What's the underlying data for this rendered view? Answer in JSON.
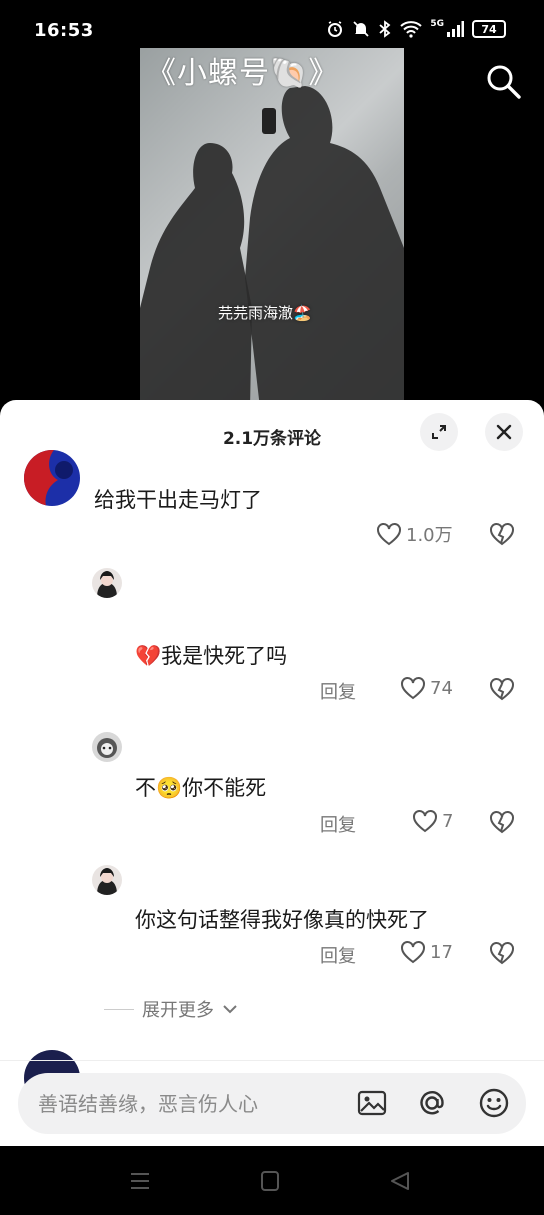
{
  "status_bar": {
    "time": "16:53",
    "network": "5G",
    "battery": "74",
    "icons": [
      "alarm-icon",
      "mute-icon",
      "bluetooth-icon",
      "wifi-icon",
      "signal-icon",
      "battery-icon"
    ]
  },
  "video": {
    "title": "《小螺号🐚》",
    "caption": "芫芫雨海澈🏖️"
  },
  "comments_panel": {
    "title": "2.1万条评论",
    "comments": [
      {
        "text": "给我干出走马灯了",
        "likes": "1.0万"
      },
      {
        "text": "💔我是快死了吗",
        "reply_label": "回复",
        "likes": "74"
      },
      {
        "text": "不🥺你不能死",
        "reply_label": "回复",
        "likes": "7"
      },
      {
        "text": "你这句话整得我好像真的快死了",
        "reply_label": "回复",
        "likes": "17"
      }
    ],
    "expand_more": "展开更多"
  },
  "input_bar": {
    "placeholder": "善语结善缘，恶言伤人心"
  },
  "colors": {
    "sheet_bg": "#ffffff",
    "text": "#1a1a1a",
    "muted": "#777777",
    "input_bg": "#f1f1f2"
  }
}
